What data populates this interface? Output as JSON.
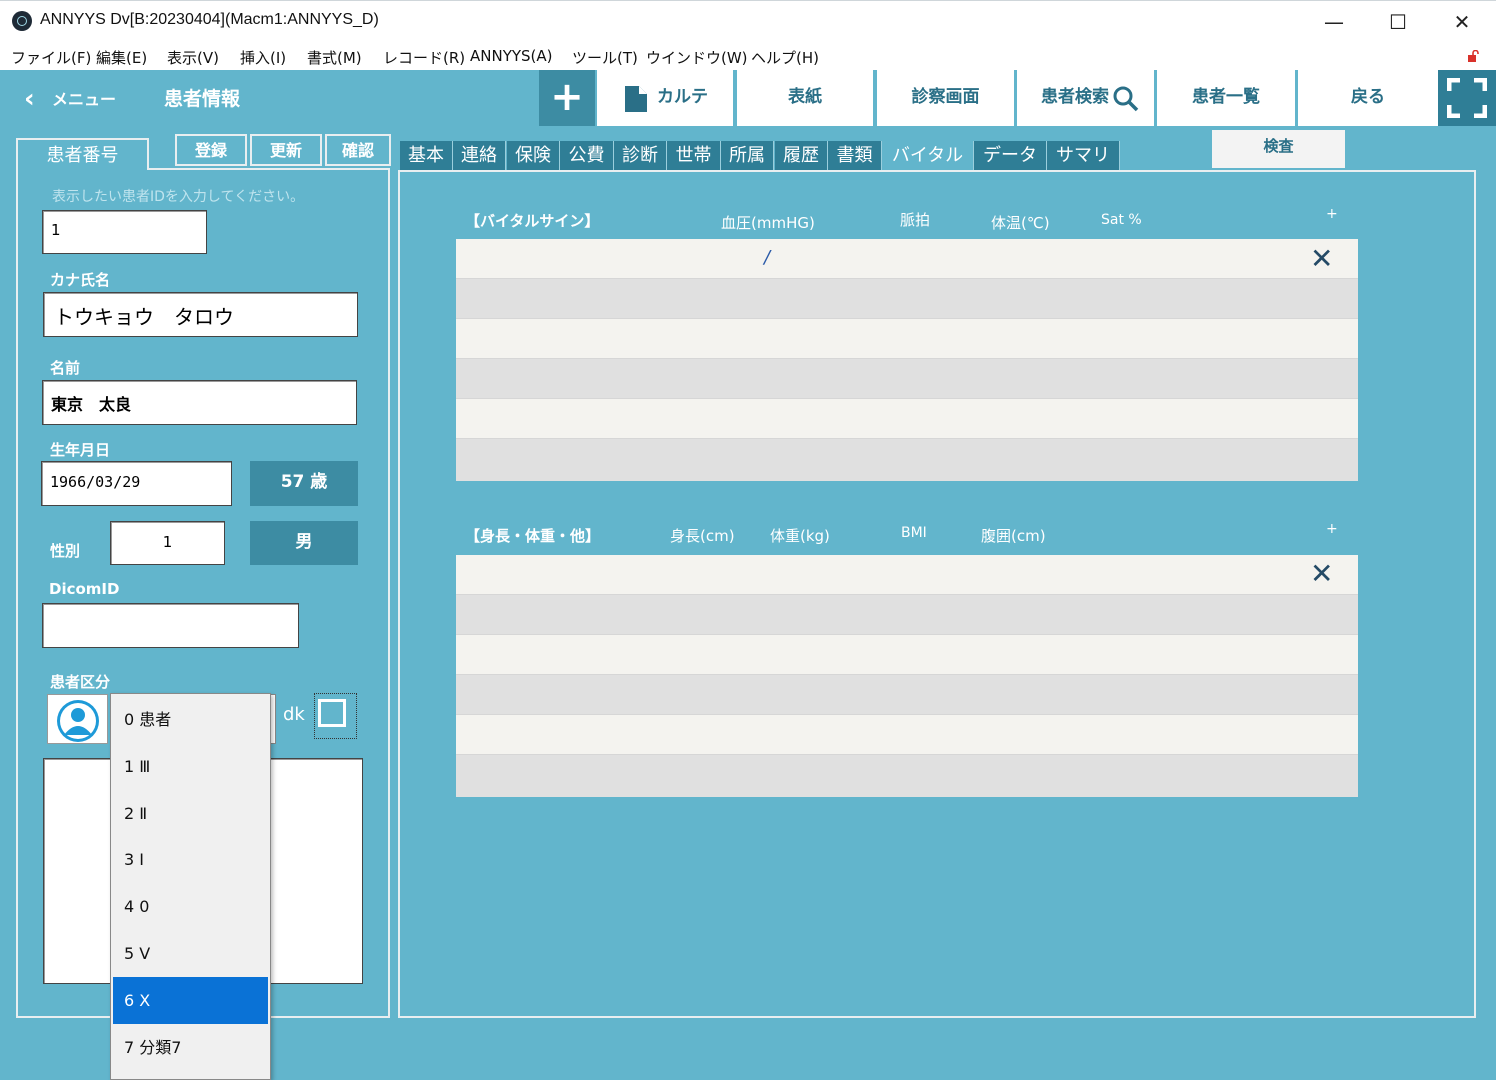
{
  "window": {
    "title": "ANNYYS Dv[B:20230404](Macm1:ANNYYS_D)",
    "minimize": "—",
    "maximize": "☐",
    "close": "✕"
  },
  "menu": [
    "ファイル(F)",
    "編集(E)",
    "表示(V)",
    "挿入(I)",
    "書式(M)",
    "レコード(R)",
    "ANNYYS(A)",
    "ツール(T)",
    "ウインドウ(W)",
    "ヘルプ(H)"
  ],
  "header": {
    "back_chevron": "‹",
    "menu_label": "メニュー",
    "page_title": "患者情報",
    "add": "+",
    "buttons": {
      "karte": "カルテ",
      "cover": "表紙",
      "exam_screen": "診察画面",
      "patient_search": "患者検索",
      "patient_list": "患者一覧",
      "back": "戻る"
    }
  },
  "left": {
    "patient_no_tab": "患者番号",
    "register": "登録",
    "update": "更新",
    "confirm": "確認",
    "hint": "表示したい患者IDを入力してください。",
    "patient_id": "1",
    "kana_label": "カナ氏名",
    "kana_value": "トウキョウ　タロウ",
    "name_label": "名前",
    "name_value": "東京　太良",
    "dob_label": "生年月日",
    "dob_value": "1966/03/29",
    "age": "57 歳",
    "sex_label": "性別",
    "sex_code": "1",
    "sex_value": "男",
    "dicom_label": "DicomID",
    "dicom_value": "",
    "category_label": "患者区分",
    "dk_label": "dk"
  },
  "tabs": [
    "基本",
    "連絡",
    "保険",
    "公費",
    "診断",
    "世帯",
    "所属",
    "履歴",
    "書類",
    "バイタル",
    "データ",
    "サマリ"
  ],
  "active_tab": "バイタル",
  "exam_tab": "検査",
  "vitals": {
    "section_title": "【バイタルサイン】",
    "columns": [
      "血圧(mmHG)",
      "脈拍",
      "体温(℃)",
      "Sat %"
    ],
    "add": "+",
    "bp_separator": "/",
    "delete": "✕"
  },
  "body": {
    "section_title": "【身長・体重・他】",
    "columns": [
      "身長(cm)",
      "体重(kg)",
      "BMI",
      "腹囲(cm)"
    ],
    "add": "+",
    "delete": "✕"
  },
  "dropdown": {
    "options": [
      "0 患者",
      "1 Ⅲ",
      "2 Ⅱ",
      "3 Ⅰ",
      "4 0",
      "5 Ⅴ",
      "6 Ⅹ",
      "7 分類7"
    ],
    "selected_index": 6
  },
  "colors": {
    "accent": "#62b5cc",
    "dark_accent": "#2f7e96",
    "selection": "#0a72d6"
  }
}
